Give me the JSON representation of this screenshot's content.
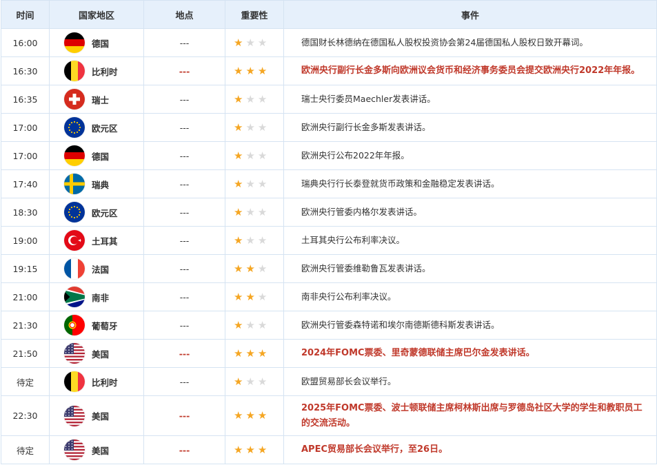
{
  "headers": {
    "time": "时间",
    "country": "国家地区",
    "location": "地点",
    "importance": "重要性",
    "event": "事件"
  },
  "colors": {
    "highlight_text": "#c0392b",
    "header_bg": "#e6f0fb",
    "star_on": "#f5a623",
    "star_off": "#d9d9d9"
  },
  "rows": [
    {
      "time": "16:00",
      "flag": "germany-flag-icon",
      "country": "德国",
      "location": "---",
      "stars": 1,
      "event": "德国财长林德纳在德国私人股权投资协会第24届德国私人股权日致开幕词。",
      "highlight": false
    },
    {
      "time": "16:30",
      "flag": "belgium-flag-icon",
      "country": "比利时",
      "location": "---",
      "stars": 3,
      "event": "欧洲央行副行长金多斯向欧洲议会货币和经济事务委员会提交欧洲央行2022年年报。",
      "highlight": true
    },
    {
      "time": "16:35",
      "flag": "switzerland-flag-icon",
      "country": "瑞士",
      "location": "---",
      "stars": 1,
      "event": "瑞士央行委员Maechler发表讲话。",
      "highlight": false
    },
    {
      "time": "17:00",
      "flag": "eu-flag-icon",
      "country": "欧元区",
      "location": "---",
      "stars": 1,
      "event": "欧洲央行副行长金多斯发表讲话。",
      "highlight": false
    },
    {
      "time": "17:00",
      "flag": "germany-flag-icon",
      "country": "德国",
      "location": "---",
      "stars": 1,
      "event": "欧洲央行公布2022年年报。",
      "highlight": false
    },
    {
      "time": "17:40",
      "flag": "sweden-flag-icon",
      "country": "瑞典",
      "location": "---",
      "stars": 1,
      "event": "瑞典央行行长泰登就货币政策和金融稳定发表讲话。",
      "highlight": false
    },
    {
      "time": "18:30",
      "flag": "eu-flag-icon",
      "country": "欧元区",
      "location": "---",
      "stars": 1,
      "event": "欧洲央行管委内格尔发表讲话。",
      "highlight": false
    },
    {
      "time": "19:00",
      "flag": "turkey-flag-icon",
      "country": "土耳其",
      "location": "---",
      "stars": 1,
      "event": "土耳其央行公布利率决议。",
      "highlight": false
    },
    {
      "time": "19:15",
      "flag": "france-flag-icon",
      "country": "法国",
      "location": "---",
      "stars": 2,
      "event": "欧洲央行管委维勒鲁瓦发表讲话。",
      "highlight": false
    },
    {
      "time": "21:00",
      "flag": "south-africa-flag-icon",
      "country": "南非",
      "location": "---",
      "stars": 2,
      "event": "南非央行公布利率决议。",
      "highlight": false
    },
    {
      "time": "21:30",
      "flag": "portugal-flag-icon",
      "country": "葡萄牙",
      "location": "---",
      "stars": 1,
      "event": "欧洲央行管委森特诺和埃尔南德斯德科斯发表讲话。",
      "highlight": false
    },
    {
      "time": "21:50",
      "flag": "usa-flag-icon",
      "country": "美国",
      "location": "---",
      "stars": 3,
      "event": "2024年FOMC票委、里奇蒙德联储主席巴尔金发表讲话。",
      "highlight": true
    },
    {
      "time": "待定",
      "flag": "belgium-flag-icon",
      "country": "比利时",
      "location": "---",
      "stars": 1,
      "event": "欧盟贸易部长会议举行。",
      "highlight": false
    },
    {
      "time": "22:30",
      "flag": "usa-flag-icon",
      "country": "美国",
      "location": "---",
      "stars": 3,
      "event": "2025年FOMC票委、波士顿联储主席柯林斯出席与罗德岛社区大学的学生和教职员工的交流活动。",
      "highlight": true
    },
    {
      "time": "待定",
      "flag": "usa-flag-icon",
      "country": "美国",
      "location": "---",
      "stars": 3,
      "event": "APEC贸易部长会议举行，至26日。",
      "highlight": true
    }
  ]
}
